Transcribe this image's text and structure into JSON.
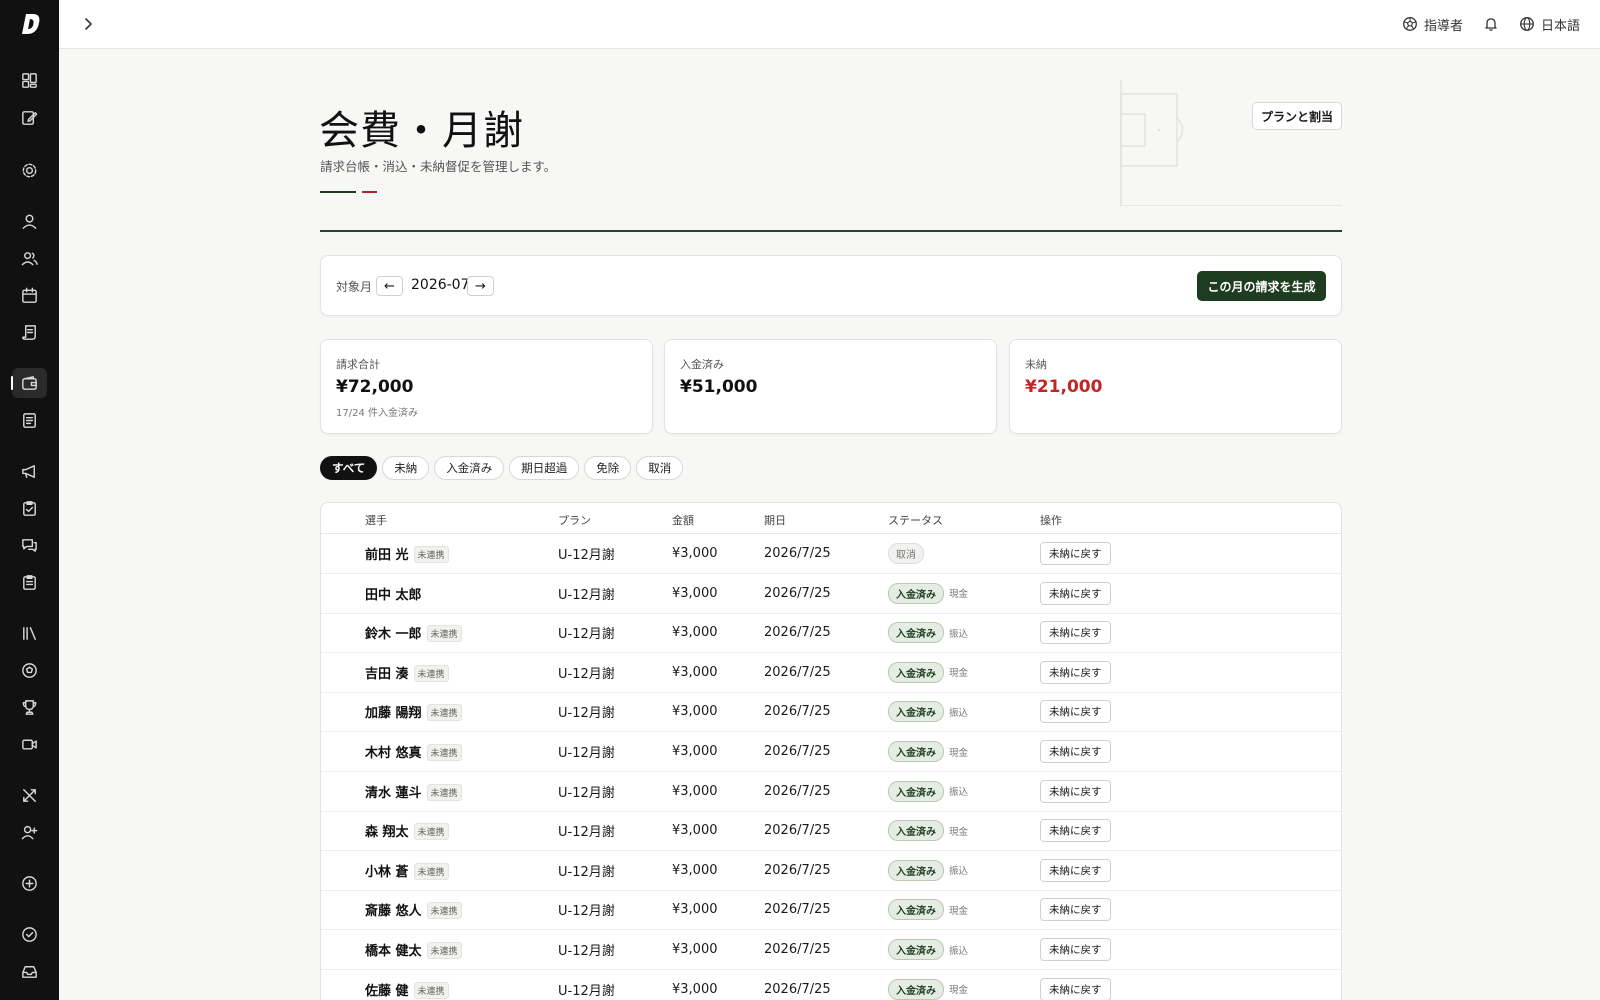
{
  "topbar": {
    "role_label": "指導者",
    "language_label": "日本語"
  },
  "header": {
    "title": "会費・月謝",
    "subtitle": "請求台帳・消込・未納督促を管理します。",
    "plan_button": "プランと割当"
  },
  "month": {
    "label": "対象月",
    "value": "2026-07",
    "prev": "←",
    "next": "→",
    "generate_button": "この月の請求を生成"
  },
  "stats": [
    {
      "label": "請求合計",
      "value": "¥72,000",
      "sub": "17/24 件入金済み"
    },
    {
      "label": "入金済み",
      "value": "¥51,000",
      "sub": ""
    },
    {
      "label": "未納",
      "value": "¥21,000",
      "sub": ""
    }
  ],
  "filters": [
    "すべて",
    "未納",
    "入金済み",
    "期日超過",
    "免除",
    "取消"
  ],
  "table": {
    "headers": [
      "選手",
      "プラン",
      "金額",
      "期日",
      "ステータス",
      "操作"
    ],
    "rows": [
      {
        "name": "前田 光",
        "tag": "未連携",
        "plan": "U-12月謝",
        "amount": "¥3,000",
        "due": "2026/7/25",
        "status": "取消",
        "method": "",
        "action": "未納に戻す"
      },
      {
        "name": "田中 太郎",
        "tag": "",
        "plan": "U-12月謝",
        "amount": "¥3,000",
        "due": "2026/7/25",
        "status": "入金済み",
        "method": "現金",
        "action": "未納に戻す"
      },
      {
        "name": "鈴木 一郎",
        "tag": "未連携",
        "plan": "U-12月謝",
        "amount": "¥3,000",
        "due": "2026/7/25",
        "status": "入金済み",
        "method": "振込",
        "action": "未納に戻す"
      },
      {
        "name": "吉田 湊",
        "tag": "未連携",
        "plan": "U-12月謝",
        "amount": "¥3,000",
        "due": "2026/7/25",
        "status": "入金済み",
        "method": "現金",
        "action": "未納に戻す"
      },
      {
        "name": "加藤 陽翔",
        "tag": "未連携",
        "plan": "U-12月謝",
        "amount": "¥3,000",
        "due": "2026/7/25",
        "status": "入金済み",
        "method": "振込",
        "action": "未納に戻す"
      },
      {
        "name": "木村 悠真",
        "tag": "未連携",
        "plan": "U-12月謝",
        "amount": "¥3,000",
        "due": "2026/7/25",
        "status": "入金済み",
        "method": "現金",
        "action": "未納に戻す"
      },
      {
        "name": "清水 蓮斗",
        "tag": "未連携",
        "plan": "U-12月謝",
        "amount": "¥3,000",
        "due": "2026/7/25",
        "status": "入金済み",
        "method": "振込",
        "action": "未納に戻す"
      },
      {
        "name": "森 翔太",
        "tag": "未連携",
        "plan": "U-12月謝",
        "amount": "¥3,000",
        "due": "2026/7/25",
        "status": "入金済み",
        "method": "現金",
        "action": "未納に戻す"
      },
      {
        "name": "小林 蒼",
        "tag": "未連携",
        "plan": "U-12月謝",
        "amount": "¥3,000",
        "due": "2026/7/25",
        "status": "入金済み",
        "method": "振込",
        "action": "未納に戻す"
      },
      {
        "name": "斎藤 悠人",
        "tag": "未連携",
        "plan": "U-12月謝",
        "amount": "¥3,000",
        "due": "2026/7/25",
        "status": "入金済み",
        "method": "現金",
        "action": "未納に戻す"
      },
      {
        "name": "橋本 健太",
        "tag": "未連携",
        "plan": "U-12月謝",
        "amount": "¥3,000",
        "due": "2026/7/25",
        "status": "入金済み",
        "method": "振込",
        "action": "未納に戻す"
      },
      {
        "name": "佐藤 健",
        "tag": "未連携",
        "plan": "U-12月謝",
        "amount": "¥3,000",
        "due": "2026/7/25",
        "status": "入金済み",
        "method": "現金",
        "action": "未納に戻す"
      }
    ]
  },
  "sidebar": {
    "icons": [
      "dashboard-icon",
      "edit-note-icon",
      "settings-icon",
      "user-icon",
      "users-icon",
      "calendar-icon",
      "scroll-icon",
      "wallet-icon",
      "ledger-icon",
      "megaphone-icon",
      "clipboard-check-icon",
      "chat-icon",
      "clipboard-list-icon",
      "library-icon",
      "soccer-ball-icon",
      "trophy-icon",
      "video-icon",
      "tactics-icon",
      "add-user-icon",
      "plus-circle-icon",
      "check-circle-icon",
      "inbox-icon"
    ],
    "active": "wallet-icon"
  },
  "colors": {
    "accent": "#1e3d20",
    "danger": "#c22525",
    "sidebar": "#111111"
  }
}
